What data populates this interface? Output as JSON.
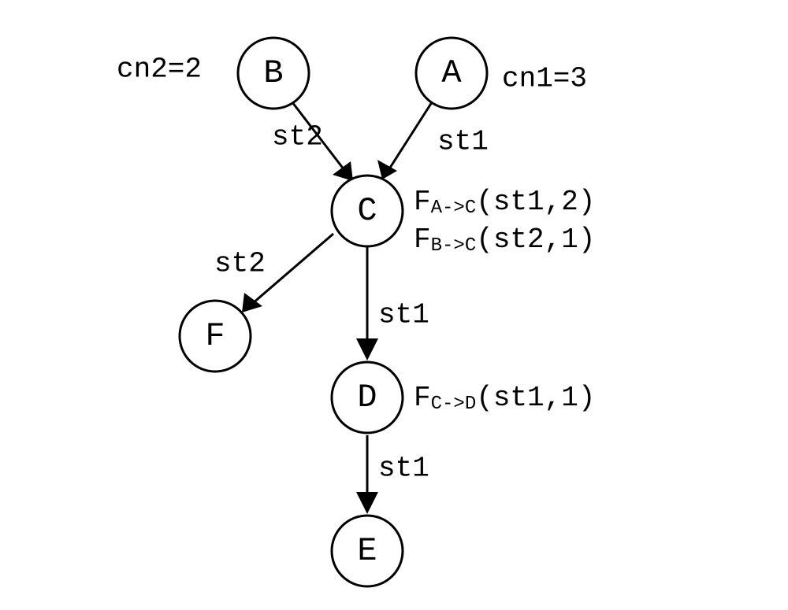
{
  "nodes": {
    "A": {
      "label": "A",
      "annotation": "cn1=3"
    },
    "B": {
      "label": "B",
      "annotation": "cn2=2"
    },
    "C": {
      "label": "C",
      "annotations": [
        {
          "prefix": "F",
          "sub": "A->C",
          "args": "(st1,2)"
        },
        {
          "prefix": "F",
          "sub": "B->C",
          "args": "(st2,1)"
        }
      ]
    },
    "D": {
      "label": "D",
      "annotations": [
        {
          "prefix": "F",
          "sub": "C->D",
          "args": "(st1,1)"
        }
      ]
    },
    "E": {
      "label": "E"
    },
    "F": {
      "label": "F"
    }
  },
  "edges": {
    "AC": {
      "label": "st1"
    },
    "BC": {
      "label": "st2"
    },
    "CD": {
      "label": "st1"
    },
    "CF": {
      "label": "st2"
    },
    "DE": {
      "label": "st1"
    }
  },
  "chart_data": {
    "type": "graph",
    "directed": true,
    "nodes": [
      {
        "id": "A",
        "cn": 3
      },
      {
        "id": "B",
        "cn": 2
      },
      {
        "id": "C",
        "F": [
          {
            "from": "A",
            "to": "C",
            "st": "st1",
            "val": 2
          },
          {
            "from": "B",
            "to": "C",
            "st": "st2",
            "val": 1
          }
        ]
      },
      {
        "id": "D",
        "F": [
          {
            "from": "C",
            "to": "D",
            "st": "st1",
            "val": 1
          }
        ]
      },
      {
        "id": "E"
      },
      {
        "id": "F"
      }
    ],
    "edges": [
      {
        "from": "A",
        "to": "C",
        "label": "st1"
      },
      {
        "from": "B",
        "to": "C",
        "label": "st2"
      },
      {
        "from": "C",
        "to": "D",
        "label": "st1"
      },
      {
        "from": "C",
        "to": "F",
        "label": "st2"
      },
      {
        "from": "D",
        "to": "E",
        "label": "st1"
      }
    ]
  }
}
